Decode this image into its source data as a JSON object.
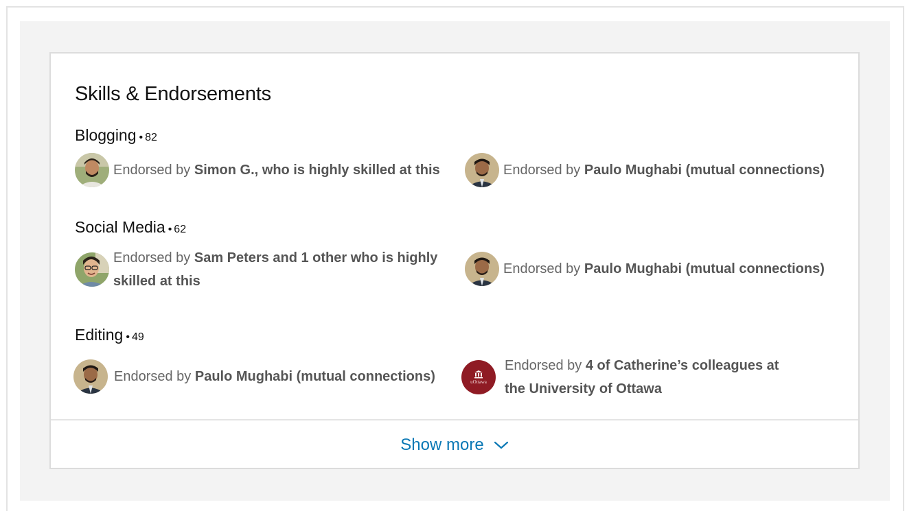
{
  "section": {
    "title": "Skills & Endorsements"
  },
  "skills": [
    {
      "name": "Blogging",
      "separator": "•",
      "count": "82",
      "endorsements": [
        {
          "prefix": "Endorsed by ",
          "highlight": "Simon G., who is highly skilled at this",
          "suffix": "",
          "avatar": "person-simon"
        },
        {
          "prefix": "Endorsed by ",
          "highlight": "Paulo Mughabi (mutual connections)",
          "suffix": "",
          "avatar": "person-paulo"
        }
      ]
    },
    {
      "name": "Social Media",
      "separator": "•",
      "count": "62",
      "endorsements": [
        {
          "prefix": "Endorsed by ",
          "highlight": "Sam Peters and 1 other who is highly skilled at this",
          "suffix": "",
          "avatar": "person-sam"
        },
        {
          "prefix": "Endorsed by ",
          "highlight": "Paulo Mughabi (mutual connections)",
          "suffix": "",
          "avatar": "person-paulo"
        }
      ]
    },
    {
      "name": "Editing",
      "separator": "•",
      "count": "49",
      "endorsements": [
        {
          "prefix": "Endorsed by ",
          "highlight": "Paulo Mughabi (mutual connections)",
          "suffix": "",
          "avatar": "person-paulo"
        },
        {
          "prefix": "Endorsed by ",
          "highlight": "4 of Catherine’s colleagues at the University of Ottawa",
          "suffix": "",
          "avatar": "uottawa-logo"
        }
      ]
    }
  ],
  "show_more": {
    "label": "Show more",
    "icon": "chevron-down-icon"
  },
  "colors": {
    "link": "#0a78b5",
    "uottawa": "#8f1b24"
  },
  "logo_text": "uOttawa"
}
